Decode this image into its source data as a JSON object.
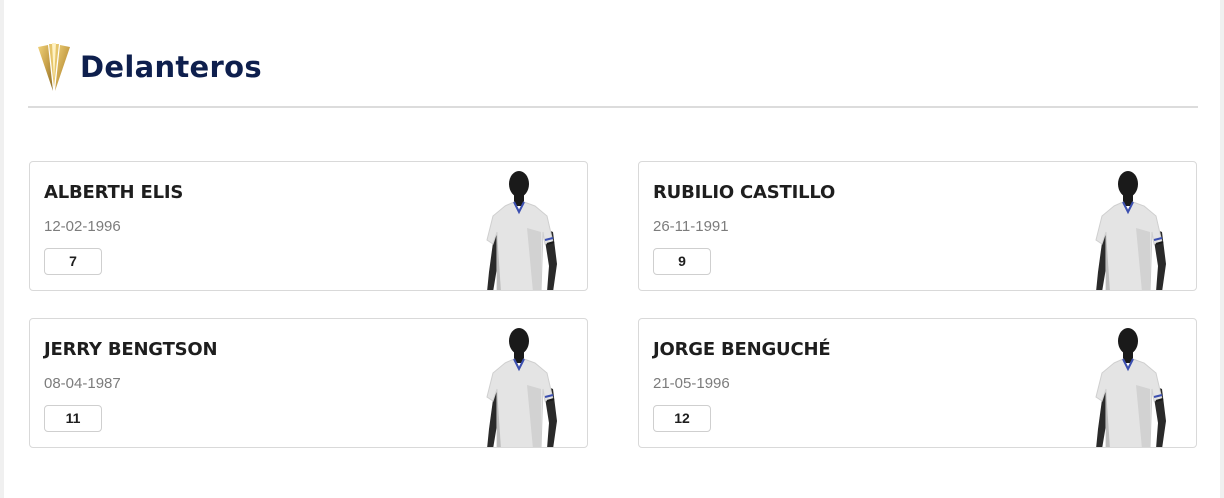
{
  "section": {
    "title": "Delanteros",
    "logo_icon": "gold-trophy-logo-icon"
  },
  "colors": {
    "title": "#0e1f4d",
    "gold": "#c9a24a",
    "card_border": "#d9d9d9",
    "date_text": "#7c7c7c"
  },
  "players": [
    {
      "name": "ALBERTH ELIS",
      "birthdate": "12-02-1996",
      "number": "7",
      "image_icon": "player-silhouette-icon"
    },
    {
      "name": "RUBILIO CASTILLO",
      "birthdate": "26-11-1991",
      "number": "9",
      "image_icon": "player-silhouette-icon"
    },
    {
      "name": "JERRY BENGTSON",
      "birthdate": "08-04-1987",
      "number": "11",
      "image_icon": "player-silhouette-icon"
    },
    {
      "name": "JORGE BENGUCHÉ",
      "birthdate": "21-05-1996",
      "number": "12",
      "image_icon": "player-silhouette-icon"
    }
  ]
}
